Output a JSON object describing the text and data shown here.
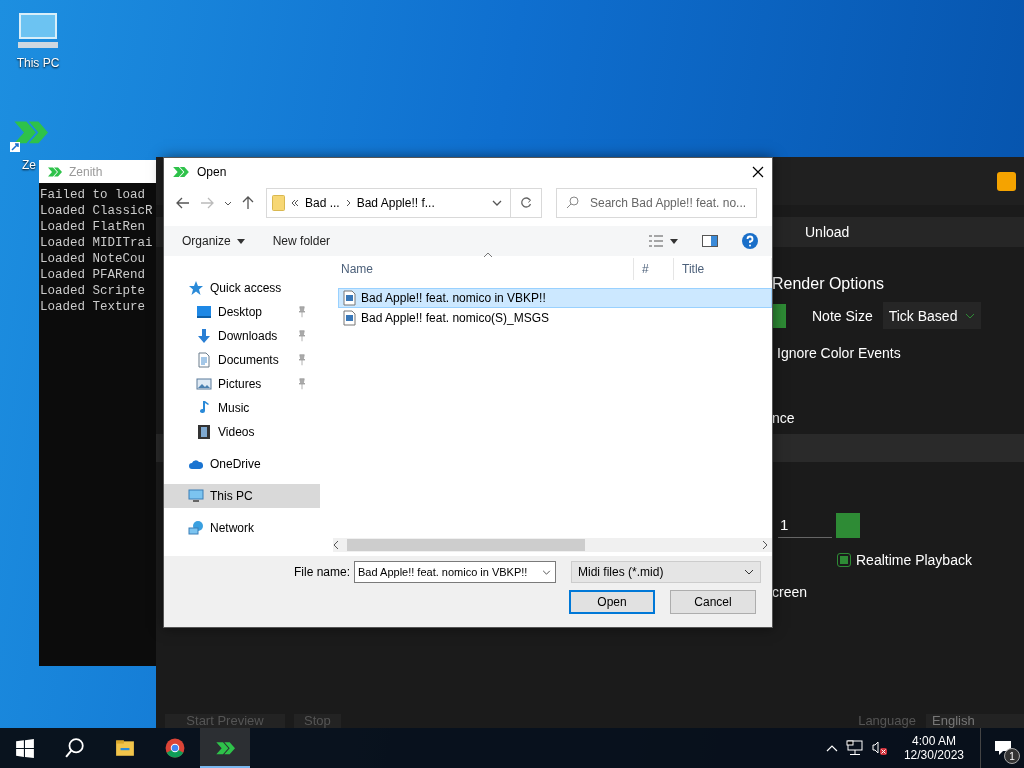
{
  "desktop": {
    "icons": [
      {
        "kind": "pc",
        "label": "This PC"
      },
      {
        "kind": "zenith_shortcut",
        "label": "Ze"
      }
    ]
  },
  "console_window": {
    "title": "Zenith",
    "lines": [
      "Failed to load",
      "Loaded ClassicR",
      "Loaded FlatRen",
      "Loaded MIDITrai",
      "Loaded NoteCou",
      "Loaded PFARend",
      "Loaded Scripte",
      "Loaded Texture"
    ]
  },
  "zenith_window": {
    "unload_button": "Unload",
    "render_options_heading": "Render Options",
    "note_size": {
      "label": "Note Size",
      "value": "Tick Based"
    },
    "ignore_color_events_label": "Ignore Color Events",
    "label_fragment_1": "nce",
    "number_field": {
      "value": "1"
    },
    "realtime_playback": {
      "label": "Realtime Playback",
      "checked": true
    },
    "label_fragment_2": "creen",
    "bottom_buttons": [
      "Start Preview",
      "Stop"
    ],
    "language": {
      "label": "Language",
      "value": "English"
    }
  },
  "open_dialog": {
    "title": "Open",
    "breadcrumb": [
      "Bad ...",
      "Bad Apple!! f..."
    ],
    "search": {
      "placeholder": "Search Bad Apple!! feat. no..."
    },
    "toolbar": {
      "organize": "Organize",
      "new_folder": "New folder"
    },
    "nav_items": [
      {
        "kind": "star",
        "label": "Quick access",
        "selected": false,
        "children": [
          {
            "kind": "desktop",
            "label": "Desktop",
            "pinned": true,
            "selected": false
          },
          {
            "kind": "download",
            "label": "Downloads",
            "pinned": true,
            "selected": false
          },
          {
            "kind": "document",
            "label": "Documents",
            "pinned": true,
            "selected": false
          },
          {
            "kind": "picture",
            "label": "Pictures",
            "pinned": true,
            "selected": false
          },
          {
            "kind": "music",
            "label": "Music",
            "pinned": false,
            "selected": false
          },
          {
            "kind": "video",
            "label": "Videos",
            "pinned": false,
            "selected": false
          }
        ]
      },
      {
        "kind": "cloud",
        "label": "OneDrive",
        "selected": false
      },
      {
        "kind": "pc",
        "label": "This PC",
        "selected": true
      },
      {
        "kind": "network",
        "label": "Network",
        "selected": false
      }
    ],
    "columns": [
      "Name",
      "#",
      "Title"
    ],
    "files": [
      {
        "name": "Bad Apple!! feat. nomico in VBKP!!",
        "selected": true
      },
      {
        "name": "Bad Apple!! feat. nomico(S)_MSGS",
        "selected": false
      }
    ],
    "file_name_label": "File name:",
    "file_name_value": "Bad Apple!! feat. nomico in VBKP!!",
    "file_type": "Midi files (*.mid)",
    "buttons": [
      {
        "label": "Open",
        "default": true
      },
      {
        "label": "Cancel",
        "default": false
      }
    ]
  },
  "taskbar": {
    "apps": [
      {
        "kind": "start",
        "active": false
      },
      {
        "kind": "search",
        "active": false
      },
      {
        "kind": "explorer",
        "active": false
      },
      {
        "kind": "chrome",
        "active": false
      },
      {
        "kind": "zenith",
        "active": true
      }
    ],
    "time": "4:00 AM",
    "date": "12/30/2023",
    "notification_count": "1"
  }
}
